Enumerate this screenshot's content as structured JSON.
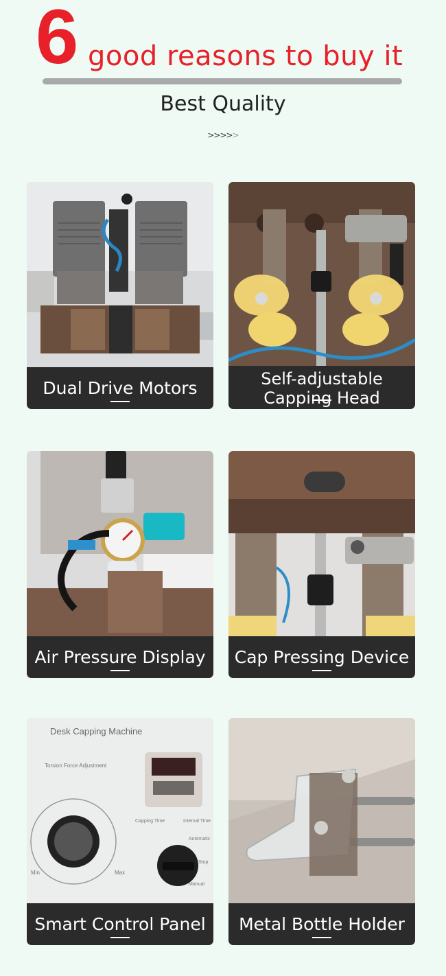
{
  "header": {
    "number": "6",
    "headline": "good reasons to buy it",
    "subtitle": "Best Quality",
    "chevrons": ">>>>",
    "chevrons_fade": ">"
  },
  "colors": {
    "accent": "#e8202a",
    "caption_bg": "#2b2b2b",
    "page_bg": "#eefaf3"
  },
  "features": [
    {
      "label": "Dual Drive Motors"
    },
    {
      "label": "Self-adjustable Capping Head",
      "line1": "Self-adjustable",
      "line2": "Capping Head"
    },
    {
      "label": "Air Pressure Display"
    },
    {
      "label": "Cap Pressing Device"
    },
    {
      "label": "Smart Control Panel"
    },
    {
      "label": "Metal Bottle Holder"
    }
  ],
  "control_panel": {
    "title": "Desk Capping Machine",
    "torsion": "Torsion Force Adjustment",
    "min": "Min",
    "max": "Max",
    "capping_time": "Capping Time",
    "interval_time": "Interval Time",
    "automatic": "Automatic",
    "stop": "Stop",
    "manual": "Manual"
  }
}
